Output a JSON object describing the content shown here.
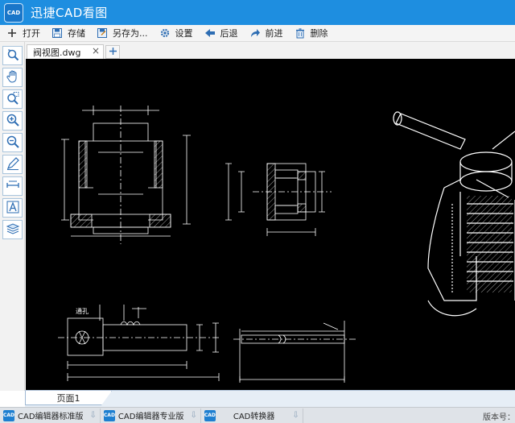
{
  "app": {
    "title": "迅捷CAD看图",
    "logo_text": "CAD"
  },
  "toolbar": {
    "open": "打开",
    "save": "存储",
    "save_as": "另存为...",
    "settings": "设置",
    "back": "后退",
    "forward": "前进",
    "delete": "删除"
  },
  "left_tools": [
    {
      "icon": "rotate-view-icon"
    },
    {
      "icon": "pan-hand-icon"
    },
    {
      "icon": "zoom-window-icon"
    },
    {
      "icon": "zoom-in-icon"
    },
    {
      "icon": "zoom-out-icon"
    },
    {
      "icon": "pen-icon"
    },
    {
      "icon": "measure-icon"
    },
    {
      "icon": "text-icon"
    },
    {
      "icon": "layers-icon"
    }
  ],
  "tabs": {
    "document": "阀视图.dwg",
    "close": "×",
    "add": "+"
  },
  "drawing": {
    "annotation": "通孔"
  },
  "pages": {
    "current": "页面1"
  },
  "taskbar": {
    "items": [
      "CAD编辑器标准版",
      "CAD编辑器专业版",
      "CAD转换器"
    ],
    "version": "版本号："
  },
  "colors": {
    "title_bar": "#1e8ee0",
    "canvas": "#000000",
    "accent": "#1e7fd0"
  }
}
